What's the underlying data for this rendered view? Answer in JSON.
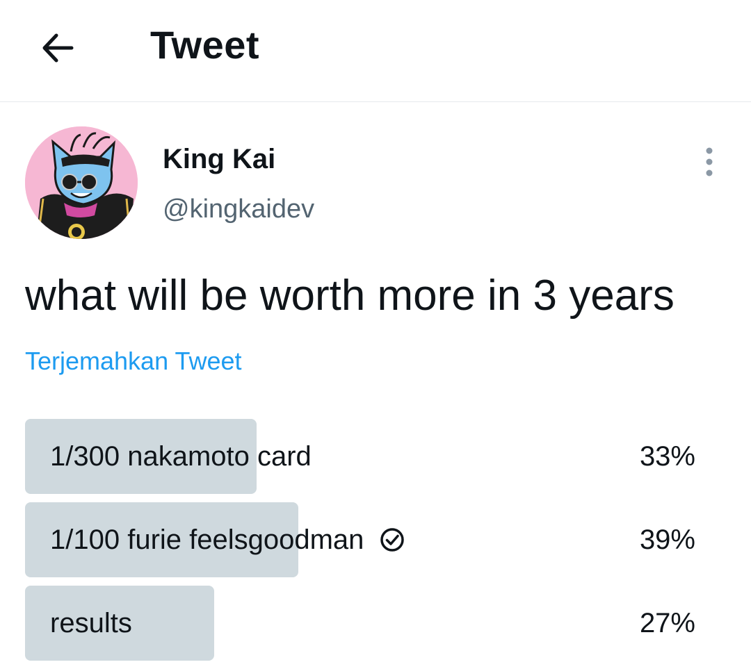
{
  "header": {
    "title": "Tweet",
    "back_icon": "arrow-left-icon"
  },
  "author": {
    "name": "King Kai",
    "handle": "@kingkaidev",
    "avatar": "cartoon-cat-avatar"
  },
  "more_icon": "more-vertical-icon",
  "tweet": {
    "text": "what will be worth more in 3 years",
    "translate_label": "Terjemahkan Tweet"
  },
  "poll": {
    "options": [
      {
        "label": "1/300 nakamoto card",
        "percent_label": "33%",
        "fraction": 0.33,
        "voted": false
      },
      {
        "label": "1/100 furie feelsgoodman",
        "percent_label": "39%",
        "fraction": 0.39,
        "voted": true
      },
      {
        "label": "results",
        "percent_label": "27%",
        "fraction": 0.27,
        "voted": false
      }
    ]
  },
  "colors": {
    "link": "#1d9bf0",
    "poll_bar": "#cfd9de",
    "secondary_text": "#536471",
    "avatar_bg": "#f6b7d3",
    "avatar_face": "#7ec3ef"
  }
}
